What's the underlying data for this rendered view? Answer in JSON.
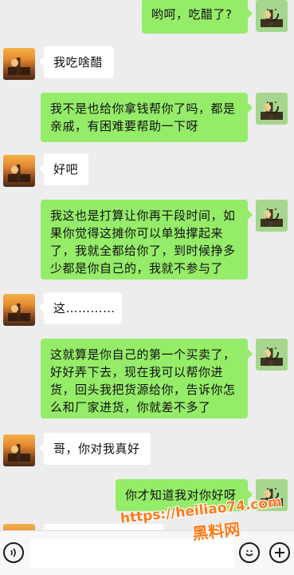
{
  "messages": [
    {
      "from": "me",
      "text": "哟呵，吃醋了?"
    },
    {
      "from": "other",
      "text": "我吃啥醋"
    },
    {
      "from": "me",
      "text": "我不是也给你拿钱帮你了吗，都是亲戚，有困难要帮助一下呀"
    },
    {
      "from": "other",
      "text": "好吧"
    },
    {
      "from": "me",
      "text": "我这也是打算让你再干段时间，如果你觉得这摊你可以单独撑起来了，我就全都给你了，到时候挣多少都是你自己的，我就不参与了"
    },
    {
      "from": "other",
      "text": "这…………"
    },
    {
      "from": "me",
      "text": "这就算是你自己的第一个买卖了，好好弄下去，现在我可以帮你进货，回头我把货源给你，告诉你怎么和厂家进货，你就差不多了"
    },
    {
      "from": "other",
      "text": "哥，你对我真好"
    },
    {
      "from": "me",
      "text": "你才知道我对你好呀"
    }
  ],
  "watermark": {
    "url": "https://heiliao74.com",
    "name": "黑料网"
  },
  "icons": {
    "voice": "voice-icon",
    "emoji": "emoji-icon",
    "add": "add-icon"
  }
}
